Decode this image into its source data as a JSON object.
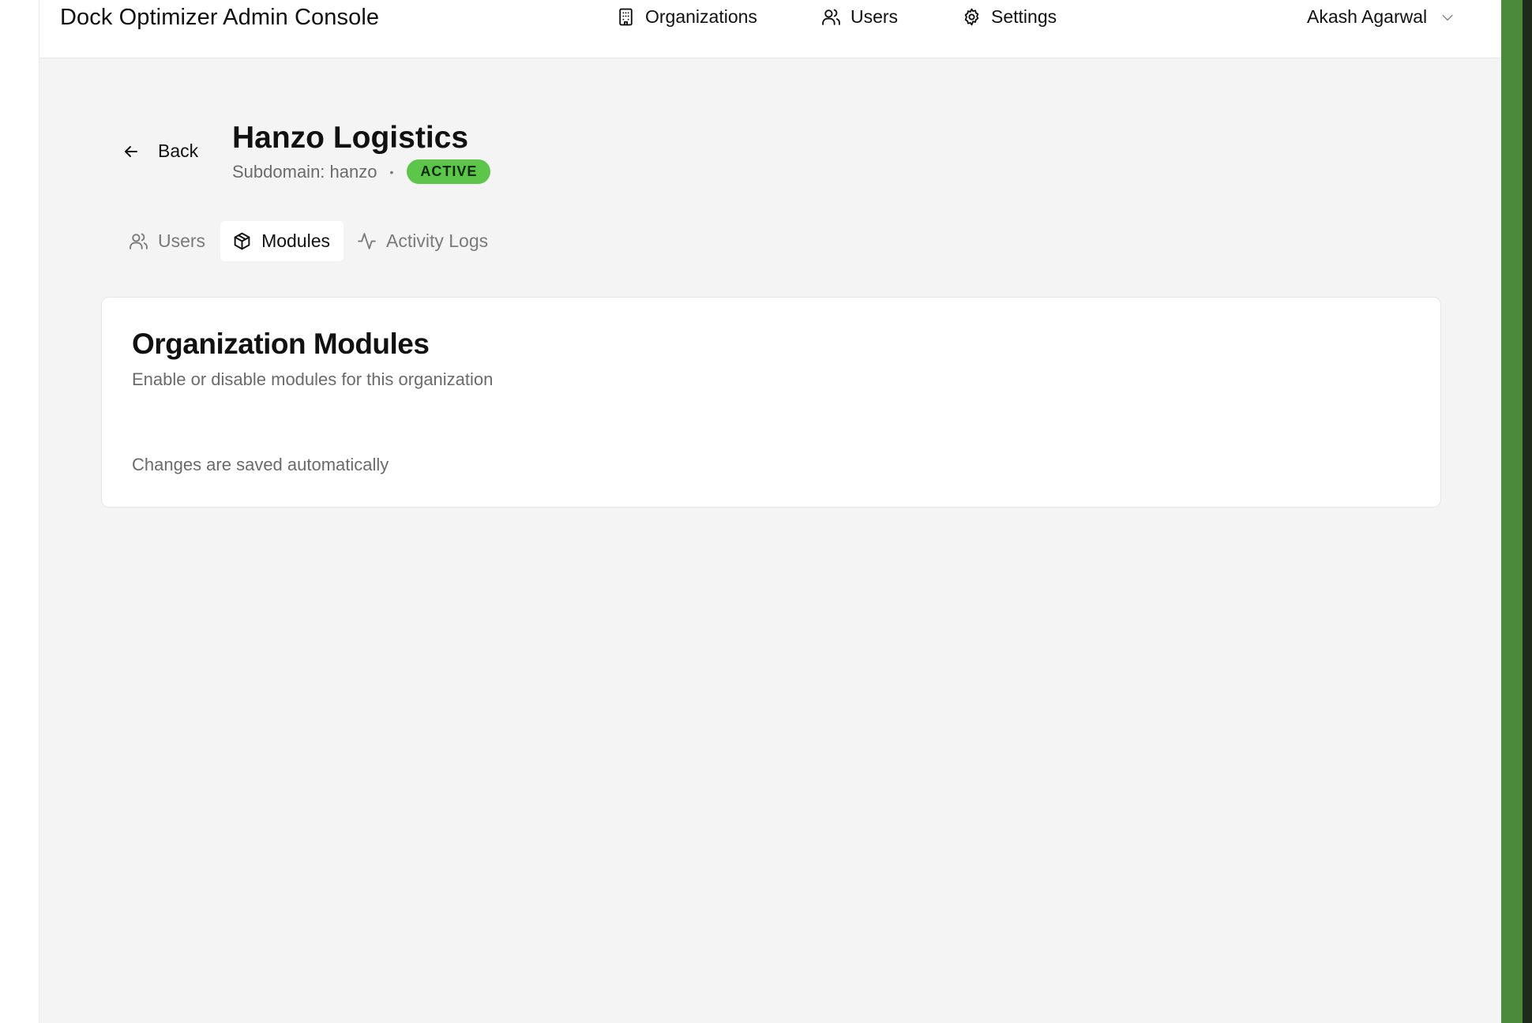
{
  "header": {
    "brand": "Dock Optimizer Admin Console",
    "nav": {
      "organizations": "Organizations",
      "users": "Users",
      "settings": "Settings"
    },
    "user_name": "Akash Agarwal"
  },
  "org": {
    "back_label": "Back",
    "name": "Hanzo Logistics",
    "subdomain": "Subdomain: hanzo",
    "separator": "•",
    "status": "ACTIVE",
    "status_color": "#5cc54a"
  },
  "tabs": [
    {
      "label": "Users",
      "icon": "users-icon",
      "active": false
    },
    {
      "label": "Modules",
      "icon": "package-icon",
      "active": true
    },
    {
      "label": "Activity Logs",
      "icon": "activity-icon",
      "active": false
    }
  ],
  "modules_card": {
    "title": "Organization Modules",
    "description": "Enable or disable modules for this organization",
    "note": "Changes are saved automatically"
  }
}
